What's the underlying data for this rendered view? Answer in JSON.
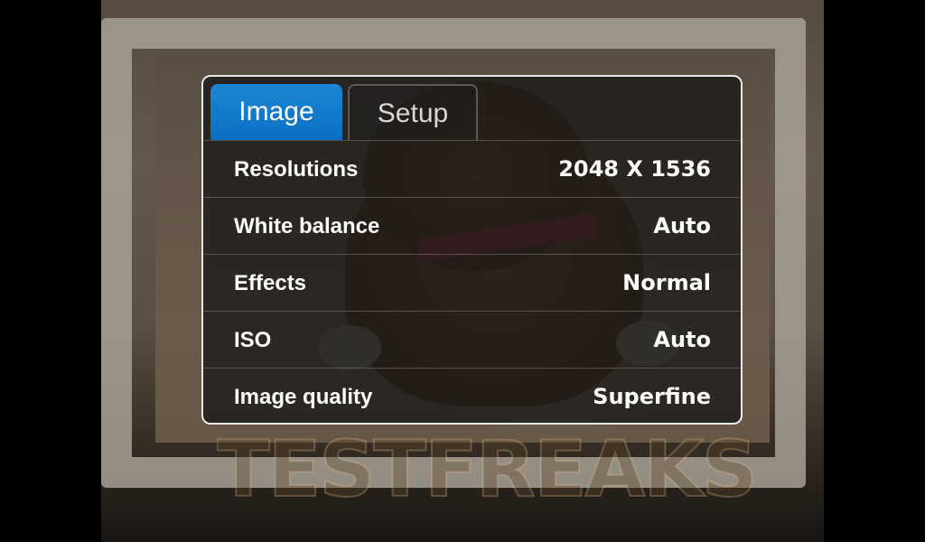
{
  "tabs": [
    {
      "label": "Image",
      "active": true
    },
    {
      "label": "Setup",
      "active": false
    }
  ],
  "settings": [
    {
      "label": "Resolutions",
      "value": "2048 X 1536"
    },
    {
      "label": "White balance",
      "value": "Auto"
    },
    {
      "label": "Effects",
      "value": "Normal"
    },
    {
      "label": "ISO",
      "value": "Auto"
    },
    {
      "label": "Image quality",
      "value": "Superfine"
    }
  ],
  "watermark": "TESTFREAKS",
  "colors": {
    "active_tab": "#0a6fc2",
    "panel_border": "#e8e8e8",
    "text": "#ffffff"
  }
}
